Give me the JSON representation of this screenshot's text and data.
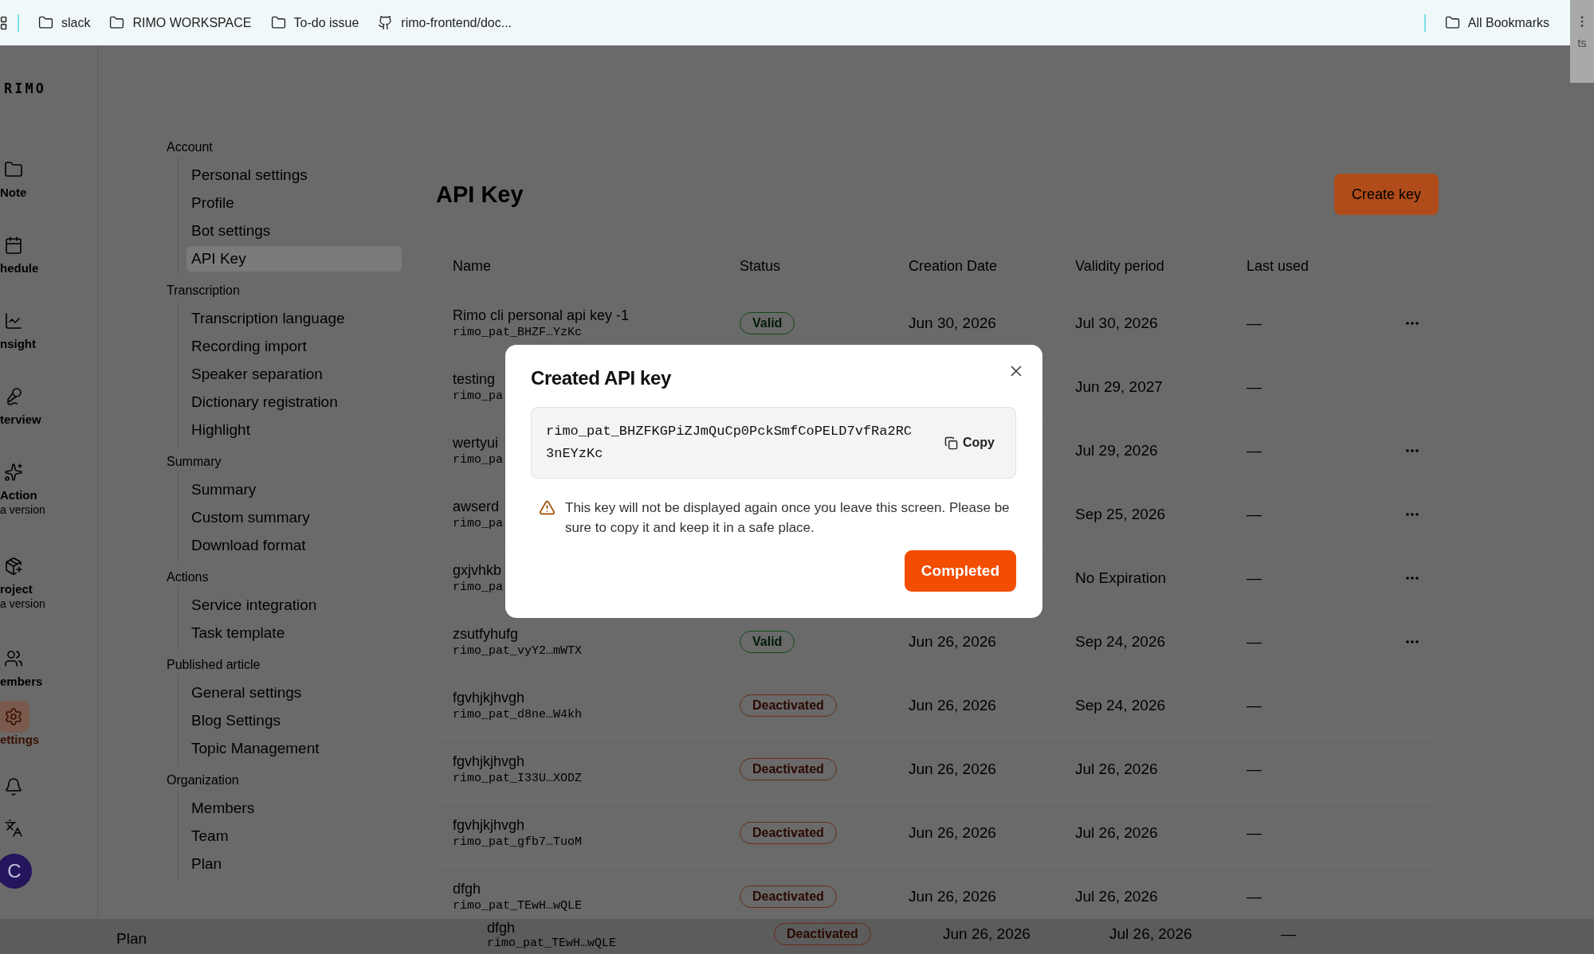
{
  "bookmarks_bar": {
    "items": [
      {
        "kind": "folder",
        "label": "slack"
      },
      {
        "kind": "folder",
        "label": "RIMO WORKSPACE"
      },
      {
        "kind": "folder",
        "label": "To-do issue"
      },
      {
        "kind": "github",
        "label": "rimo-frontend/doc..."
      }
    ],
    "right_item": {
      "kind": "folder",
      "label": "All Bookmarks"
    },
    "edge_text": "ts"
  },
  "logo": "RIMO",
  "rail": [
    {
      "kind": "folder",
      "label": "Note",
      "selected": false
    },
    {
      "kind": "calendar",
      "label": "hedule",
      "selected": false
    },
    {
      "kind": "chart",
      "label": "nsight",
      "selected": false
    },
    {
      "kind": "mic",
      "label": "terview",
      "selected": false
    },
    {
      "kind": "sparkles",
      "label": "Action",
      "sublabel": "a version",
      "selected": false
    },
    {
      "kind": "package",
      "label": "roject",
      "sublabel": "a version",
      "selected": false
    },
    {
      "kind": "users",
      "label": "embers",
      "selected": false
    },
    {
      "kind": "settings",
      "label": "ettings",
      "selected": true
    },
    {
      "kind": "bell"
    },
    {
      "kind": "translate"
    },
    {
      "kind": "avatar",
      "label": "C"
    }
  ],
  "settings_nav": [
    {
      "title": "Account",
      "items": [
        {
          "label": "Personal settings",
          "selected": false
        },
        {
          "label": "Profile",
          "selected": false
        },
        {
          "label": "Bot settings",
          "selected": false
        },
        {
          "label": "API Key",
          "selected": true
        }
      ]
    },
    {
      "title": "Transcription",
      "items": [
        {
          "label": "Transcription language",
          "selected": false
        },
        {
          "label": "Recording import",
          "selected": false
        },
        {
          "label": "Speaker separation",
          "selected": false
        },
        {
          "label": "Dictionary registration",
          "selected": false
        },
        {
          "label": "Highlight",
          "selected": false
        }
      ]
    },
    {
      "title": "Summary",
      "items": [
        {
          "label": "Summary",
          "selected": false
        },
        {
          "label": "Custom summary",
          "selected": false
        },
        {
          "label": "Download format",
          "selected": false
        }
      ]
    },
    {
      "title": "Actions",
      "items": [
        {
          "label": "Service integration",
          "selected": false
        },
        {
          "label": "Task template",
          "selected": false
        }
      ]
    },
    {
      "title": "Published article",
      "items": [
        {
          "label": "General settings",
          "selected": false
        },
        {
          "label": "Blog Settings",
          "selected": false
        },
        {
          "label": "Topic Management",
          "selected": false
        }
      ]
    },
    {
      "title": "Organization",
      "items": [
        {
          "label": "Members",
          "selected": false
        },
        {
          "label": "Team",
          "selected": false
        },
        {
          "label": "Plan",
          "selected": false
        }
      ]
    }
  ],
  "page_title": "API Key",
  "create_button": "Create key",
  "table": {
    "columns": [
      "Name",
      "Status",
      "Creation Date",
      "Validity period",
      "Last used"
    ],
    "rows": [
      {
        "name": "Rimo cli personal api key -1",
        "key": "rimo_pat_BHZF…YzKc",
        "status": "Valid",
        "created": "Jun 30, 2026",
        "validity": "Jul 30, 2026",
        "last_used": "—",
        "menu": true
      },
      {
        "name": "testing",
        "key": "rimo_pa",
        "validity": "Jun 29, 2027",
        "last_used": "—",
        "menu": false
      },
      {
        "name": "wertyui",
        "key": "rimo_pa",
        "validity": "Jul 29, 2026",
        "last_used": "—",
        "menu": true
      },
      {
        "name": "awserd",
        "key": "rimo_pa",
        "validity": "Sep 25, 2026",
        "last_used": "—",
        "menu": true
      },
      {
        "name": "gxjvhkb",
        "key": "rimo_pa",
        "validity": "No Expiration",
        "last_used": "—",
        "menu": true
      },
      {
        "name": "zsutfyhufg",
        "key": "rimo_pat_vyY2…mWTX",
        "status": "Valid",
        "created": "Jun 26, 2026",
        "validity": "Sep 24, 2026",
        "last_used": "—",
        "menu": true
      },
      {
        "name": "fgvhjkjhvgh",
        "key": "rimo_pat_d8ne…W4kh",
        "status": "Deactivated",
        "created": "Jun 26, 2026",
        "validity": "Sep 24, 2026",
        "last_used": "—",
        "menu": false
      },
      {
        "name": "fgvhjkjhvgh",
        "key": "rimo_pat_I33U…XODZ",
        "status": "Deactivated",
        "created": "Jun 26, 2026",
        "validity": "Jul 26, 2026",
        "last_used": "—",
        "menu": false
      },
      {
        "name": "fgvhjkjhvgh",
        "key": "rimo_pat_gfb7…TuoM",
        "status": "Deactivated",
        "created": "Jun 26, 2026",
        "validity": "Jul 26, 2026",
        "last_used": "—",
        "menu": false
      },
      {
        "name": "dfgh",
        "key": "rimo_pat_TEwH…wQLE",
        "status": "Deactivated",
        "created": "Jun 26, 2026",
        "validity": "Jul 26, 2026",
        "last_used": "—",
        "menu": false
      }
    ]
  },
  "ghost_strip": {
    "nav_item": "Plan",
    "row": {
      "name": "dfgh",
      "key": "rimo_pat_TEwH…wQLE",
      "status": "Deactivated",
      "created": "Jun 26, 2026",
      "validity": "Jul 26, 2026",
      "last_used": "—"
    }
  },
  "modal": {
    "title": "Created API key",
    "api_key": "rimo_pat_BHZFKGPiZJmQuCp0PckSmfCoPELD7vfRa2RC3nEYzKc",
    "copy_button": "Copy",
    "warning": "This key will not be displayed again once you leave this screen. Please be sure to copy it and keep it in a safe place.",
    "confirm_button": "Completed"
  }
}
